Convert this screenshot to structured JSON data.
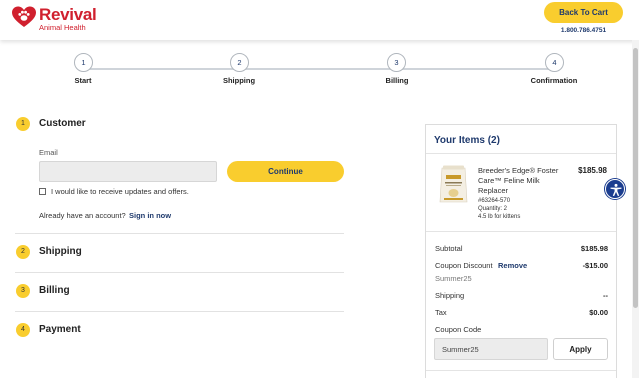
{
  "header": {
    "brand_name": "Revival",
    "brand_sub": "Animal Health",
    "back_button": "Back To Cart",
    "phone": "1.800.786.4751",
    "brand_color": "#d0202e",
    "accent_color": "#f9cd2e",
    "navy_color": "#1f3a6d"
  },
  "steps": [
    {
      "number": "1",
      "label": "Start"
    },
    {
      "number": "2",
      "label": "Shipping"
    },
    {
      "number": "3",
      "label": "Billing"
    },
    {
      "number": "4",
      "label": "Confirmation"
    }
  ],
  "checkout": {
    "customer": {
      "number": "1",
      "title": "Customer",
      "email_label": "Email",
      "email_value": "",
      "continue_button": "Continue",
      "newsletter_label": "I would like to receive updates and offers.",
      "newsletter_checked": false,
      "account_prompt": "Already have an account?",
      "sign_in_link": "Sign in now"
    },
    "shipping": {
      "number": "2",
      "title": "Shipping"
    },
    "billing": {
      "number": "3",
      "title": "Billing"
    },
    "payment": {
      "number": "4",
      "title": "Payment"
    }
  },
  "cart": {
    "title": "Your Items (2)",
    "item": {
      "name": "Breeder's Edge® Foster Care™ Feline Milk Replacer",
      "price": "$185.98",
      "sku": "#63264-570",
      "quantity": "Quantity: 2",
      "size": "4.5 lb for kittens"
    },
    "summary": {
      "subtotal_label": "Subtotal",
      "subtotal_value": "$185.98",
      "discount_label": "Coupon Discount",
      "discount_remove": "Remove",
      "discount_value": "-$15.00",
      "discount_code": "Summer25",
      "shipping_label": "Shipping",
      "shipping_value": "--",
      "tax_label": "Tax",
      "tax_value": "$0.00",
      "coupon_label": "Coupon Code",
      "coupon_value": "Summer25",
      "apply_button": "Apply"
    }
  },
  "accessibility": {
    "icon": "accessibility-icon"
  }
}
